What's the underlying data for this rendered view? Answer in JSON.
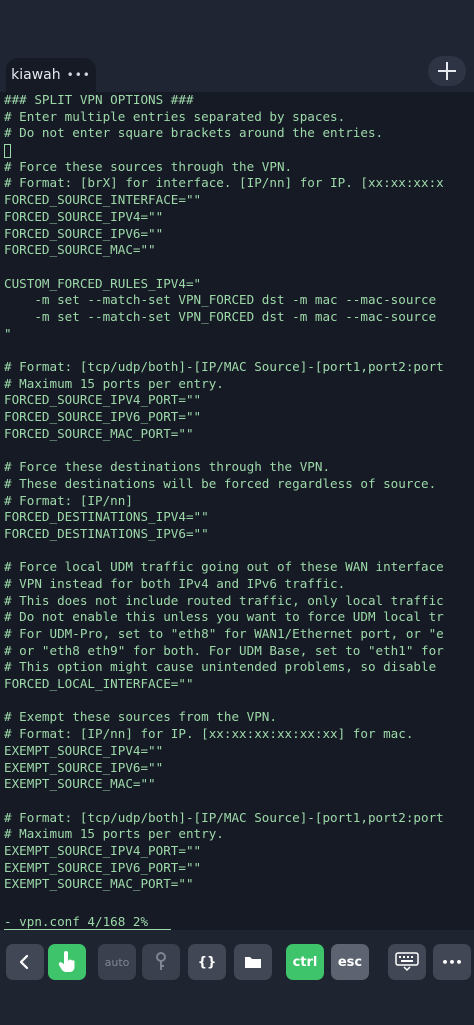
{
  "tab": {
    "title": "kiawah",
    "menu_glyph": "•••"
  },
  "terminal": {
    "lines": [
      "### SPLIT VPN OPTIONS ###",
      "# Enter multiple entries separated by spaces.",
      "# Do not enter square brackets around the entries.",
      "",
      "# Force these sources through the VPN.",
      "# Format: [brX] for interface. [IP/nn] for IP. [xx:xx:xx:x",
      "FORCED_SOURCE_INTERFACE=\"\"",
      "FORCED_SOURCE_IPV4=\"\"",
      "FORCED_SOURCE_IPV6=\"\"",
      "FORCED_SOURCE_MAC=\"\"",
      "",
      "CUSTOM_FORCED_RULES_IPV4=\"",
      "    -m set --match-set VPN_FORCED dst -m mac --mac-source",
      "    -m set --match-set VPN_FORCED dst -m mac --mac-source",
      "\"",
      "",
      "# Format: [tcp/udp/both]-[IP/MAC Source]-[port1,port2:port",
      "# Maximum 15 ports per entry.",
      "FORCED_SOURCE_IPV4_PORT=\"\"",
      "FORCED_SOURCE_IPV6_PORT=\"\"",
      "FORCED_SOURCE_MAC_PORT=\"\"",
      "",
      "# Force these destinations through the VPN.",
      "# These destinations will be forced regardless of source.",
      "# Format: [IP/nn]",
      "FORCED_DESTINATIONS_IPV4=\"\"",
      "FORCED_DESTINATIONS_IPV6=\"\"",
      "",
      "# Force local UDM traffic going out of these WAN interface",
      "# VPN instead for both IPv4 and IPv6 traffic.",
      "# This does not include routed traffic, only local traffic",
      "# Do not enable this unless you want to force UDM local tr",
      "# For UDM-Pro, set to \"eth8\" for WAN1/Ethernet port, or \"e",
      "# or \"eth8 eth9\" for both. For UDM Base, set to \"eth1\" for",
      "# This option might cause unintended problems, so disable",
      "FORCED_LOCAL_INTERFACE=\"\"",
      "",
      "# Exempt these sources from the VPN.",
      "# Format: [IP/nn] for IP. [xx:xx:xx:xx:xx:xx] for mac.",
      "EXEMPT_SOURCE_IPV4=\"\"",
      "EXEMPT_SOURCE_IPV6=\"\"",
      "EXEMPT_SOURCE_MAC=\"\"",
      "",
      "# Format: [tcp/udp/both]-[IP/MAC Source]-[port1,port2:port",
      "# Maximum 15 ports per entry.",
      "EXEMPT_SOURCE_IPV4_PORT=\"\"",
      "EXEMPT_SOURCE_IPV6_PORT=\"\"",
      "EXEMPT_SOURCE_MAC_PORT=\"\""
    ],
    "status_line": "- vpn.conf 4/168 2%   "
  },
  "toolbar": {
    "auto_label": "auto",
    "braces_label": "{}",
    "ctrl_label": "ctrl",
    "esc_label": "esc",
    "more_label": "•••"
  },
  "colors": {
    "terminal_text": "#9ed9a9",
    "accent_green": "#3ec46a",
    "terminal_bg": "#151a25"
  }
}
